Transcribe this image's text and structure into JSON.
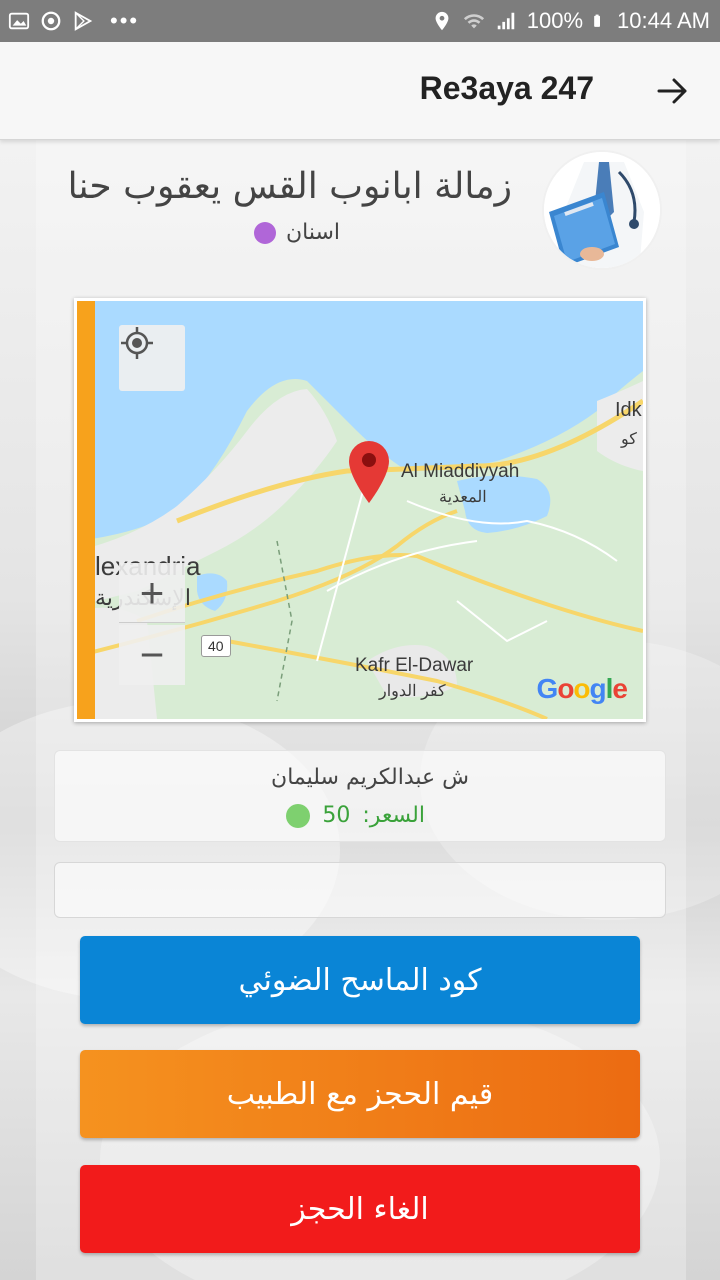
{
  "status_bar": {
    "battery": "100%",
    "time": "10:44 AM",
    "dots": "•••"
  },
  "app_bar": {
    "title": "Re3aya 247",
    "back_icon": "arrow-right-icon"
  },
  "doctor": {
    "name": "زمالة ابانوب القس يعقوب حنا",
    "specialty": "اسنان",
    "specialty_color": "#b066d8",
    "avatar_icon": "doctor-avatar-icon"
  },
  "map": {
    "labels": {
      "city": "lexandria",
      "city_ar": "الإسكندرية",
      "miaddiyyah": "Al Miaddiyyah",
      "miaddiyyah_ar": "المعدية",
      "kafr": "Kafr El-Dawar",
      "kafr_ar": "كفر الدوار",
      "idku": "Idk",
      "idku_ar": "كو",
      "road": "40"
    },
    "zoom_in": "+",
    "zoom_out": "−",
    "attribution": "Google",
    "stripe_color": "#f7a21c"
  },
  "address": {
    "street": "ش عبدالكريم سليمان",
    "price_label": "السعر:",
    "price_value": "50",
    "price_color": "#3aa23a"
  },
  "buttons": {
    "scan": "كود الماسح الضوئي",
    "rate": "قيم الحجز مع الطبيب",
    "cancel": "الغاء الحجز"
  }
}
